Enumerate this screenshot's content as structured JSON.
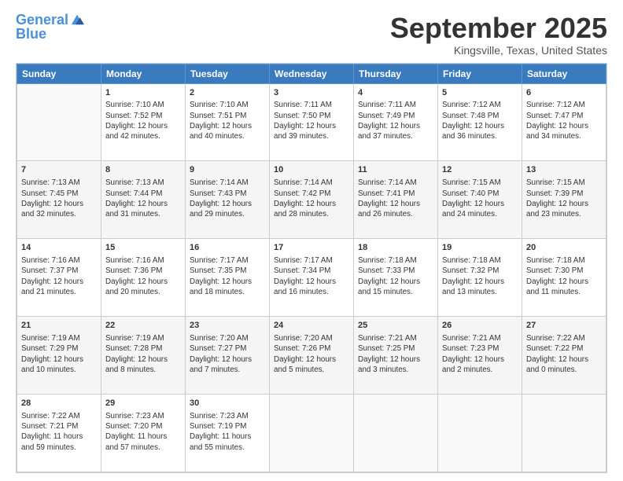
{
  "header": {
    "logo_line1": "General",
    "logo_line2": "Blue",
    "month_title": "September 2025",
    "location": "Kingsville, Texas, United States"
  },
  "days_of_week": [
    "Sunday",
    "Monday",
    "Tuesday",
    "Wednesday",
    "Thursday",
    "Friday",
    "Saturday"
  ],
  "weeks": [
    [
      {
        "day": "",
        "sunrise": "",
        "sunset": "",
        "daylight": ""
      },
      {
        "day": "1",
        "sunrise": "Sunrise: 7:10 AM",
        "sunset": "Sunset: 7:52 PM",
        "daylight": "Daylight: 12 hours and 42 minutes."
      },
      {
        "day": "2",
        "sunrise": "Sunrise: 7:10 AM",
        "sunset": "Sunset: 7:51 PM",
        "daylight": "Daylight: 12 hours and 40 minutes."
      },
      {
        "day": "3",
        "sunrise": "Sunrise: 7:11 AM",
        "sunset": "Sunset: 7:50 PM",
        "daylight": "Daylight: 12 hours and 39 minutes."
      },
      {
        "day": "4",
        "sunrise": "Sunrise: 7:11 AM",
        "sunset": "Sunset: 7:49 PM",
        "daylight": "Daylight: 12 hours and 37 minutes."
      },
      {
        "day": "5",
        "sunrise": "Sunrise: 7:12 AM",
        "sunset": "Sunset: 7:48 PM",
        "daylight": "Daylight: 12 hours and 36 minutes."
      },
      {
        "day": "6",
        "sunrise": "Sunrise: 7:12 AM",
        "sunset": "Sunset: 7:47 PM",
        "daylight": "Daylight: 12 hours and 34 minutes."
      }
    ],
    [
      {
        "day": "7",
        "sunrise": "Sunrise: 7:13 AM",
        "sunset": "Sunset: 7:45 PM",
        "daylight": "Daylight: 12 hours and 32 minutes."
      },
      {
        "day": "8",
        "sunrise": "Sunrise: 7:13 AM",
        "sunset": "Sunset: 7:44 PM",
        "daylight": "Daylight: 12 hours and 31 minutes."
      },
      {
        "day": "9",
        "sunrise": "Sunrise: 7:14 AM",
        "sunset": "Sunset: 7:43 PM",
        "daylight": "Daylight: 12 hours and 29 minutes."
      },
      {
        "day": "10",
        "sunrise": "Sunrise: 7:14 AM",
        "sunset": "Sunset: 7:42 PM",
        "daylight": "Daylight: 12 hours and 28 minutes."
      },
      {
        "day": "11",
        "sunrise": "Sunrise: 7:14 AM",
        "sunset": "Sunset: 7:41 PM",
        "daylight": "Daylight: 12 hours and 26 minutes."
      },
      {
        "day": "12",
        "sunrise": "Sunrise: 7:15 AM",
        "sunset": "Sunset: 7:40 PM",
        "daylight": "Daylight: 12 hours and 24 minutes."
      },
      {
        "day": "13",
        "sunrise": "Sunrise: 7:15 AM",
        "sunset": "Sunset: 7:39 PM",
        "daylight": "Daylight: 12 hours and 23 minutes."
      }
    ],
    [
      {
        "day": "14",
        "sunrise": "Sunrise: 7:16 AM",
        "sunset": "Sunset: 7:37 PM",
        "daylight": "Daylight: 12 hours and 21 minutes."
      },
      {
        "day": "15",
        "sunrise": "Sunrise: 7:16 AM",
        "sunset": "Sunset: 7:36 PM",
        "daylight": "Daylight: 12 hours and 20 minutes."
      },
      {
        "day": "16",
        "sunrise": "Sunrise: 7:17 AM",
        "sunset": "Sunset: 7:35 PM",
        "daylight": "Daylight: 12 hours and 18 minutes."
      },
      {
        "day": "17",
        "sunrise": "Sunrise: 7:17 AM",
        "sunset": "Sunset: 7:34 PM",
        "daylight": "Daylight: 12 hours and 16 minutes."
      },
      {
        "day": "18",
        "sunrise": "Sunrise: 7:18 AM",
        "sunset": "Sunset: 7:33 PM",
        "daylight": "Daylight: 12 hours and 15 minutes."
      },
      {
        "day": "19",
        "sunrise": "Sunrise: 7:18 AM",
        "sunset": "Sunset: 7:32 PM",
        "daylight": "Daylight: 12 hours and 13 minutes."
      },
      {
        "day": "20",
        "sunrise": "Sunrise: 7:18 AM",
        "sunset": "Sunset: 7:30 PM",
        "daylight": "Daylight: 12 hours and 11 minutes."
      }
    ],
    [
      {
        "day": "21",
        "sunrise": "Sunrise: 7:19 AM",
        "sunset": "Sunset: 7:29 PM",
        "daylight": "Daylight: 12 hours and 10 minutes."
      },
      {
        "day": "22",
        "sunrise": "Sunrise: 7:19 AM",
        "sunset": "Sunset: 7:28 PM",
        "daylight": "Daylight: 12 hours and 8 minutes."
      },
      {
        "day": "23",
        "sunrise": "Sunrise: 7:20 AM",
        "sunset": "Sunset: 7:27 PM",
        "daylight": "Daylight: 12 hours and 7 minutes."
      },
      {
        "day": "24",
        "sunrise": "Sunrise: 7:20 AM",
        "sunset": "Sunset: 7:26 PM",
        "daylight": "Daylight: 12 hours and 5 minutes."
      },
      {
        "day": "25",
        "sunrise": "Sunrise: 7:21 AM",
        "sunset": "Sunset: 7:25 PM",
        "daylight": "Daylight: 12 hours and 3 minutes."
      },
      {
        "day": "26",
        "sunrise": "Sunrise: 7:21 AM",
        "sunset": "Sunset: 7:23 PM",
        "daylight": "Daylight: 12 hours and 2 minutes."
      },
      {
        "day": "27",
        "sunrise": "Sunrise: 7:22 AM",
        "sunset": "Sunset: 7:22 PM",
        "daylight": "Daylight: 12 hours and 0 minutes."
      }
    ],
    [
      {
        "day": "28",
        "sunrise": "Sunrise: 7:22 AM",
        "sunset": "Sunset: 7:21 PM",
        "daylight": "Daylight: 11 hours and 59 minutes."
      },
      {
        "day": "29",
        "sunrise": "Sunrise: 7:23 AM",
        "sunset": "Sunset: 7:20 PM",
        "daylight": "Daylight: 11 hours and 57 minutes."
      },
      {
        "day": "30",
        "sunrise": "Sunrise: 7:23 AM",
        "sunset": "Sunset: 7:19 PM",
        "daylight": "Daylight: 11 hours and 55 minutes."
      },
      {
        "day": "",
        "sunrise": "",
        "sunset": "",
        "daylight": ""
      },
      {
        "day": "",
        "sunrise": "",
        "sunset": "",
        "daylight": ""
      },
      {
        "day": "",
        "sunrise": "",
        "sunset": "",
        "daylight": ""
      },
      {
        "day": "",
        "sunrise": "",
        "sunset": "",
        "daylight": ""
      }
    ]
  ]
}
